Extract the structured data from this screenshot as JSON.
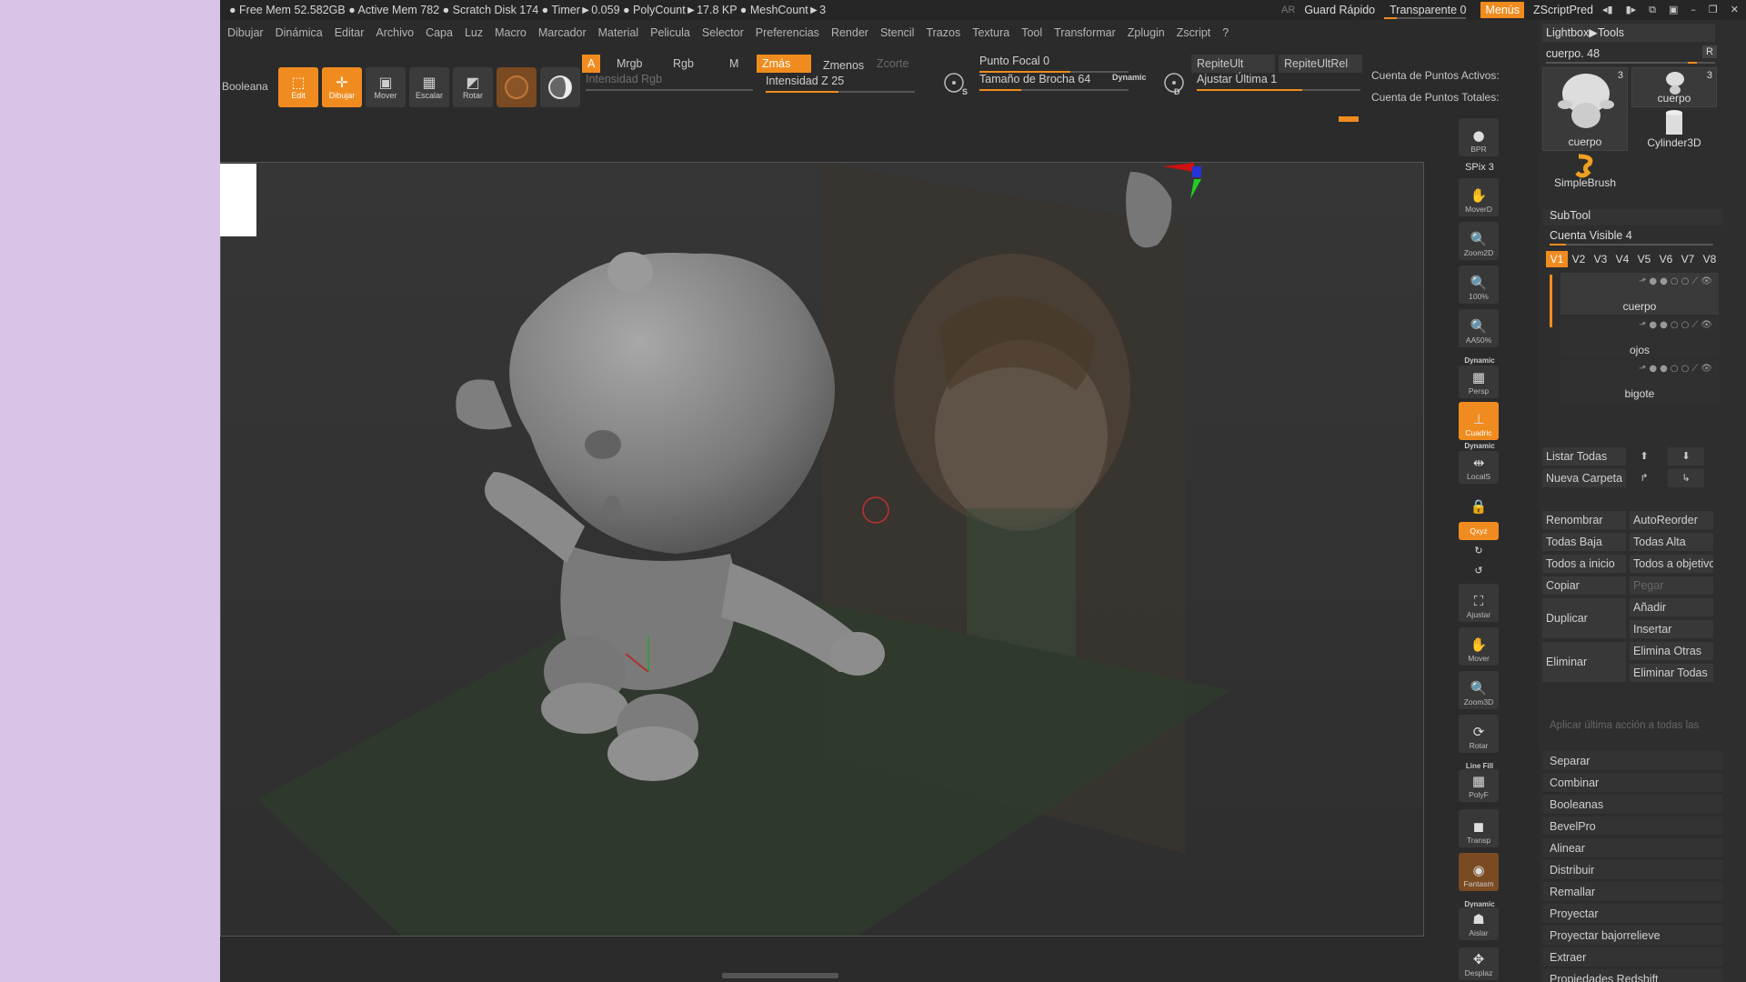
{
  "titlebar": {
    "stats": "● Free Mem 52.582GB ● Active Mem 782 ● Scratch Disk 174 ●  Timer►0.059 ● PolyCount►17.8 KP  ● MeshCount►3",
    "ar": "AR",
    "quick_save": "Guard Rápido",
    "transparent": "Transparente 0",
    "menus": "Menús",
    "script": "ZScriptPred"
  },
  "menubar": [
    "Dibujar",
    "Dinámica",
    "Editar",
    "Archivo",
    "Capa",
    "Luz",
    "Macro",
    "Marcador",
    "Material",
    "Pelicula",
    "Selector",
    "Preferencias",
    "Render",
    "Stencil",
    "Trazos",
    "Textura",
    "Tool",
    "Transformar",
    "Zplugin",
    "Zscript",
    "?"
  ],
  "toolbar": {
    "boolean_label": "Booleana",
    "edit": "Edit",
    "draw": "Dibujar",
    "move": "Mover",
    "scale": "Escalar",
    "rotate": "Rotar",
    "a": "A",
    "mrgb": "Mrgb",
    "rgb": "Rgb",
    "m": "M",
    "zadd": "Zmás",
    "zsub": "Zmenos",
    "zcut": "Zcorte",
    "rgb_intensity": "Intensidad Rgb",
    "z_intensity": "Intensidad Z 25",
    "focal": "Punto Focal 0",
    "brush_size": "Tamaño de Brocha 64",
    "dynamic": "Dynamic",
    "s_label": "S",
    "d_label": "D",
    "replay_last": "RepiteUlt",
    "replay_last_rel": "RepiteUltRel",
    "adjust_last": "Ajustar Última 1",
    "active_points": "Cuenta de Puntos Activos:",
    "total_points": "Cuenta de Puntos Totales:"
  },
  "shelf": {
    "bpr": "BPR",
    "spix": "SPix 3",
    "moverd": "MoverD",
    "zoom2d": "Zoom2D",
    "p100": "100%",
    "aahalf": "AA50%",
    "dynamic": "Dynamic",
    "persp": "Persp",
    "floor": "Cuadric",
    "locals": "LocalS",
    "xyz": "Qxyz",
    "frame": "Ajustar",
    "move": "Mover",
    "zoom3d": "Zoom3D",
    "rotate": "Rotar",
    "linefill": "Line Fill",
    "polyf": "PolyF",
    "transp": "Transp",
    "ghost": "Fantasm",
    "solo": "Aislar",
    "xpose": "Desplaz"
  },
  "panel": {
    "lightbox": "Lightbox▶Tools",
    "cuerpo_slider": "cuerpo. 48",
    "r": "R",
    "thumbs": [
      {
        "label": "cuerpo",
        "count": "3"
      },
      {
        "label": "cuerpo",
        "count": "3"
      },
      {
        "label": "Cylinder3D"
      },
      {
        "label": "SimpleBrush"
      }
    ],
    "subtool": "SubTool",
    "visible_count": "Cuenta Visible 4",
    "versions": [
      "V1",
      "V2",
      "V3",
      "V4",
      "V5",
      "V6",
      "V7",
      "V8"
    ],
    "subtools": [
      "cuerpo",
      "ojos",
      "bigote"
    ],
    "list_all": "Listar Todas",
    "new_folder": "Nueva Carpeta",
    "rename": "Renombrar",
    "autoreorder": "AutoReorder",
    "all_low": "Todas Baja",
    "all_high": "Todas Alta",
    "all_to_start": "Todos a inicio",
    "all_to_target": "Todos a objetivo",
    "copy": "Copiar",
    "paste": "Pegar",
    "duplicate": "Duplicar",
    "add": "Añadir",
    "insert": "Insertar",
    "delete": "Eliminar",
    "delete_others": "Elimina Otras",
    "delete_all": "Eliminar Todas",
    "apply_hint": "Aplicar última acción a todas las",
    "sections": [
      "Separar",
      "Combinar",
      "Booleanas",
      "BevelPro",
      "Alinear",
      "Distribuir",
      "Remallar",
      "Proyectar",
      "Proyectar bajorrelieve",
      "Extraer",
      "Propiedades Redshift"
    ]
  },
  "colors": {
    "accent": "#f08c1f",
    "background": "#2b2b2b",
    "viewport": "#333333"
  }
}
